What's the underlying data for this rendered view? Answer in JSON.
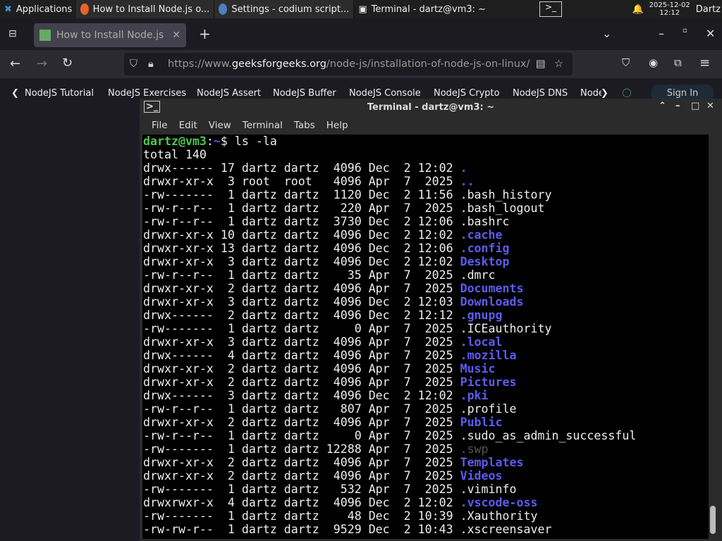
{
  "taskbar": {
    "apps": "Applications",
    "tasks": [
      "How to Install Node.js o...",
      "Settings - codium script...",
      "Terminal - dartz@vm3: ~"
    ],
    "date": "2025-12-02",
    "time": "12:12",
    "user": "Dartz"
  },
  "browser": {
    "tab_title": "How to Install Node.js on",
    "url_prefix": "https://www.",
    "url_domain": "geeksforgeeks.org",
    "url_path": "/node-js/installation-of-node-js-on-linux/",
    "bookmarks": [
      "NodeJS Tutorial",
      "NodeJS Exercises",
      "NodeJS Assert",
      "NodeJS Buffer",
      "NodeJS Console",
      "NodeJS Crypto",
      "NodeJS DNS",
      "Node"
    ],
    "sign_in": "Sign In"
  },
  "terminal": {
    "title": "Terminal - dartz@vm3: ~",
    "menu": [
      "File",
      "Edit",
      "View",
      "Terminal",
      "Tabs",
      "Help"
    ],
    "prompt_user": "dartz@vm3",
    "prompt_sep": ":",
    "prompt_path": "~",
    "prompt_sym": "$ ",
    "command": "ls -la",
    "total": "total 140",
    "rows": [
      [
        "drwx------ 17 dartz dartz  4096 Dec  2 12:02 ",
        ".",
        "dir"
      ],
      [
        "drwxr-xr-x  3 root  root   4096 Apr  7  2025 ",
        "..",
        "dir"
      ],
      [
        "-rw-------  1 dartz dartz  1120 Dec  2 11:56 ",
        ".bash_history",
        ""
      ],
      [
        "-rw-r--r--  1 dartz dartz   220 Apr  7  2025 ",
        ".bash_logout",
        ""
      ],
      [
        "-rw-r--r--  1 dartz dartz  3730 Dec  2 12:06 ",
        ".bashrc",
        ""
      ],
      [
        "drwxr-xr-x 10 dartz dartz  4096 Dec  2 12:02 ",
        ".cache",
        "dir"
      ],
      [
        "drwxr-xr-x 13 dartz dartz  4096 Dec  2 12:06 ",
        ".config",
        "dir"
      ],
      [
        "drwxr-xr-x  3 dartz dartz  4096 Dec  2 12:02 ",
        "Desktop",
        "dir"
      ],
      [
        "-rw-r--r--  1 dartz dartz    35 Apr  7  2025 ",
        ".dmrc",
        ""
      ],
      [
        "drwxr-xr-x  2 dartz dartz  4096 Apr  7  2025 ",
        "Documents",
        "dir"
      ],
      [
        "drwxr-xr-x  3 dartz dartz  4096 Dec  2 12:03 ",
        "Downloads",
        "dir"
      ],
      [
        "drwx------  2 dartz dartz  4096 Dec  2 12:12 ",
        ".gnupg",
        "dir"
      ],
      [
        "-rw-------  1 dartz dartz     0 Apr  7  2025 ",
        ".ICEauthority",
        ""
      ],
      [
        "drwxr-xr-x  3 dartz dartz  4096 Apr  7  2025 ",
        ".local",
        "dir"
      ],
      [
        "drwx------  4 dartz dartz  4096 Apr  7  2025 ",
        ".mozilla",
        "dir"
      ],
      [
        "drwxr-xr-x  2 dartz dartz  4096 Apr  7  2025 ",
        "Music",
        "dir"
      ],
      [
        "drwxr-xr-x  2 dartz dartz  4096 Apr  7  2025 ",
        "Pictures",
        "dir"
      ],
      [
        "drwx------  3 dartz dartz  4096 Dec  2 12:02 ",
        ".pki",
        "dir"
      ],
      [
        "-rw-r--r--  1 dartz dartz   807 Apr  7  2025 ",
        ".profile",
        ""
      ],
      [
        "drwxr-xr-x  2 dartz dartz  4096 Apr  7  2025 ",
        "Public",
        "dir"
      ],
      [
        "-rw-r--r--  1 dartz dartz     0 Apr  7  2025 ",
        ".sudo_as_admin_successful",
        ""
      ],
      [
        "-rw-------  1 dartz dartz 12288 Apr  7  2025 ",
        ".swp",
        "dim"
      ],
      [
        "drwxr-xr-x  2 dartz dartz  4096 Apr  7  2025 ",
        "Templates",
        "dir"
      ],
      [
        "drwxr-xr-x  2 dartz dartz  4096 Apr  7  2025 ",
        "Videos",
        "dir"
      ],
      [
        "-rw-------  1 dartz dartz   532 Apr  7  2025 ",
        ".viminfo",
        ""
      ],
      [
        "drwxrwxr-x  4 dartz dartz  4096 Dec  2 12:02 ",
        ".vscode-oss",
        "dir"
      ],
      [
        "-rw-------  1 dartz dartz    48 Dec  2 10:39 ",
        ".Xauthority",
        ""
      ],
      [
        "-rw-rw-r--  1 dartz dartz  9529 Dec  2 10:43 ",
        ".xscreensaver",
        ""
      ]
    ]
  },
  "colors": {
    "directory": "#5c5cf0",
    "prompt": "#4ec94e",
    "terminal_bg": "#000000"
  }
}
